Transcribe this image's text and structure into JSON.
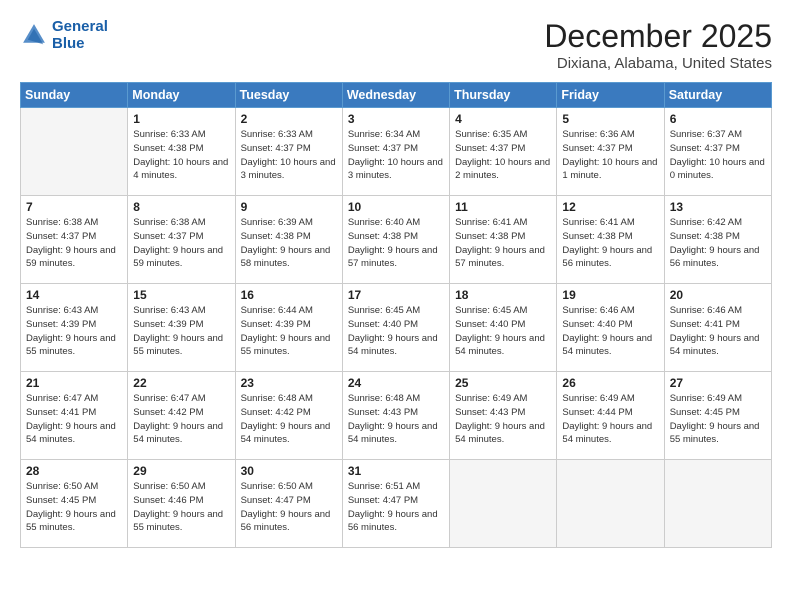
{
  "logo": {
    "line1": "General",
    "line2": "Blue"
  },
  "title": "December 2025",
  "subtitle": "Dixiana, Alabama, United States",
  "weekdays": [
    "Sunday",
    "Monday",
    "Tuesday",
    "Wednesday",
    "Thursday",
    "Friday",
    "Saturday"
  ],
  "weeks": [
    [
      {
        "day": "",
        "empty": true
      },
      {
        "day": "1",
        "sunrise": "Sunrise: 6:33 AM",
        "sunset": "Sunset: 4:38 PM",
        "daylight": "Daylight: 10 hours and 4 minutes."
      },
      {
        "day": "2",
        "sunrise": "Sunrise: 6:33 AM",
        "sunset": "Sunset: 4:37 PM",
        "daylight": "Daylight: 10 hours and 3 minutes."
      },
      {
        "day": "3",
        "sunrise": "Sunrise: 6:34 AM",
        "sunset": "Sunset: 4:37 PM",
        "daylight": "Daylight: 10 hours and 3 minutes."
      },
      {
        "day": "4",
        "sunrise": "Sunrise: 6:35 AM",
        "sunset": "Sunset: 4:37 PM",
        "daylight": "Daylight: 10 hours and 2 minutes."
      },
      {
        "day": "5",
        "sunrise": "Sunrise: 6:36 AM",
        "sunset": "Sunset: 4:37 PM",
        "daylight": "Daylight: 10 hours and 1 minute."
      },
      {
        "day": "6",
        "sunrise": "Sunrise: 6:37 AM",
        "sunset": "Sunset: 4:37 PM",
        "daylight": "Daylight: 10 hours and 0 minutes."
      }
    ],
    [
      {
        "day": "7",
        "sunrise": "Sunrise: 6:38 AM",
        "sunset": "Sunset: 4:37 PM",
        "daylight": "Daylight: 9 hours and 59 minutes."
      },
      {
        "day": "8",
        "sunrise": "Sunrise: 6:38 AM",
        "sunset": "Sunset: 4:37 PM",
        "daylight": "Daylight: 9 hours and 59 minutes."
      },
      {
        "day": "9",
        "sunrise": "Sunrise: 6:39 AM",
        "sunset": "Sunset: 4:38 PM",
        "daylight": "Daylight: 9 hours and 58 minutes."
      },
      {
        "day": "10",
        "sunrise": "Sunrise: 6:40 AM",
        "sunset": "Sunset: 4:38 PM",
        "daylight": "Daylight: 9 hours and 57 minutes."
      },
      {
        "day": "11",
        "sunrise": "Sunrise: 6:41 AM",
        "sunset": "Sunset: 4:38 PM",
        "daylight": "Daylight: 9 hours and 57 minutes."
      },
      {
        "day": "12",
        "sunrise": "Sunrise: 6:41 AM",
        "sunset": "Sunset: 4:38 PM",
        "daylight": "Daylight: 9 hours and 56 minutes."
      },
      {
        "day": "13",
        "sunrise": "Sunrise: 6:42 AM",
        "sunset": "Sunset: 4:38 PM",
        "daylight": "Daylight: 9 hours and 56 minutes."
      }
    ],
    [
      {
        "day": "14",
        "sunrise": "Sunrise: 6:43 AM",
        "sunset": "Sunset: 4:39 PM",
        "daylight": "Daylight: 9 hours and 55 minutes."
      },
      {
        "day": "15",
        "sunrise": "Sunrise: 6:43 AM",
        "sunset": "Sunset: 4:39 PM",
        "daylight": "Daylight: 9 hours and 55 minutes."
      },
      {
        "day": "16",
        "sunrise": "Sunrise: 6:44 AM",
        "sunset": "Sunset: 4:39 PM",
        "daylight": "Daylight: 9 hours and 55 minutes."
      },
      {
        "day": "17",
        "sunrise": "Sunrise: 6:45 AM",
        "sunset": "Sunset: 4:40 PM",
        "daylight": "Daylight: 9 hours and 54 minutes."
      },
      {
        "day": "18",
        "sunrise": "Sunrise: 6:45 AM",
        "sunset": "Sunset: 4:40 PM",
        "daylight": "Daylight: 9 hours and 54 minutes."
      },
      {
        "day": "19",
        "sunrise": "Sunrise: 6:46 AM",
        "sunset": "Sunset: 4:40 PM",
        "daylight": "Daylight: 9 hours and 54 minutes."
      },
      {
        "day": "20",
        "sunrise": "Sunrise: 6:46 AM",
        "sunset": "Sunset: 4:41 PM",
        "daylight": "Daylight: 9 hours and 54 minutes."
      }
    ],
    [
      {
        "day": "21",
        "sunrise": "Sunrise: 6:47 AM",
        "sunset": "Sunset: 4:41 PM",
        "daylight": "Daylight: 9 hours and 54 minutes."
      },
      {
        "day": "22",
        "sunrise": "Sunrise: 6:47 AM",
        "sunset": "Sunset: 4:42 PM",
        "daylight": "Daylight: 9 hours and 54 minutes."
      },
      {
        "day": "23",
        "sunrise": "Sunrise: 6:48 AM",
        "sunset": "Sunset: 4:42 PM",
        "daylight": "Daylight: 9 hours and 54 minutes."
      },
      {
        "day": "24",
        "sunrise": "Sunrise: 6:48 AM",
        "sunset": "Sunset: 4:43 PM",
        "daylight": "Daylight: 9 hours and 54 minutes."
      },
      {
        "day": "25",
        "sunrise": "Sunrise: 6:49 AM",
        "sunset": "Sunset: 4:43 PM",
        "daylight": "Daylight: 9 hours and 54 minutes."
      },
      {
        "day": "26",
        "sunrise": "Sunrise: 6:49 AM",
        "sunset": "Sunset: 4:44 PM",
        "daylight": "Daylight: 9 hours and 54 minutes."
      },
      {
        "day": "27",
        "sunrise": "Sunrise: 6:49 AM",
        "sunset": "Sunset: 4:45 PM",
        "daylight": "Daylight: 9 hours and 55 minutes."
      }
    ],
    [
      {
        "day": "28",
        "sunrise": "Sunrise: 6:50 AM",
        "sunset": "Sunset: 4:45 PM",
        "daylight": "Daylight: 9 hours and 55 minutes."
      },
      {
        "day": "29",
        "sunrise": "Sunrise: 6:50 AM",
        "sunset": "Sunset: 4:46 PM",
        "daylight": "Daylight: 9 hours and 55 minutes."
      },
      {
        "day": "30",
        "sunrise": "Sunrise: 6:50 AM",
        "sunset": "Sunset: 4:47 PM",
        "daylight": "Daylight: 9 hours and 56 minutes."
      },
      {
        "day": "31",
        "sunrise": "Sunrise: 6:51 AM",
        "sunset": "Sunset: 4:47 PM",
        "daylight": "Daylight: 9 hours and 56 minutes."
      },
      {
        "day": "",
        "empty": true
      },
      {
        "day": "",
        "empty": true
      },
      {
        "day": "",
        "empty": true
      }
    ]
  ]
}
